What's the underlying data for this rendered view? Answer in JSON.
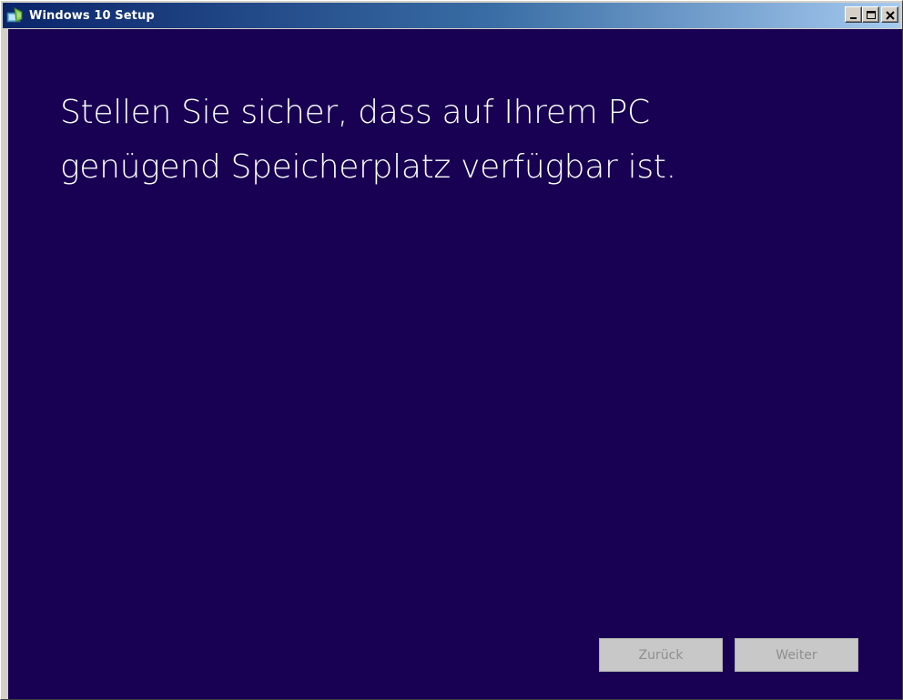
{
  "window": {
    "title": "Windows 10 Setup"
  },
  "title_controls": {
    "minimize_icon": "minimize-icon",
    "maximize_icon": "maximize-icon",
    "close_icon": "close-icon"
  },
  "main": {
    "heading_line1": "Stellen Sie sicher, dass auf Ihrem PC",
    "heading_line2": "genügend Speicherplatz verfügbar ist."
  },
  "buttons": {
    "back_label": "Zurück",
    "next_label": "Weiter",
    "back_enabled": false,
    "next_enabled": false
  },
  "colors": {
    "background": "#180152",
    "heading_text": "#ffffff",
    "button_disabled_bg": "#c8c8c8",
    "button_disabled_text": "#8e8e8e",
    "titlebar_start": "#0a246a",
    "titlebar_end": "#a6caf0"
  }
}
